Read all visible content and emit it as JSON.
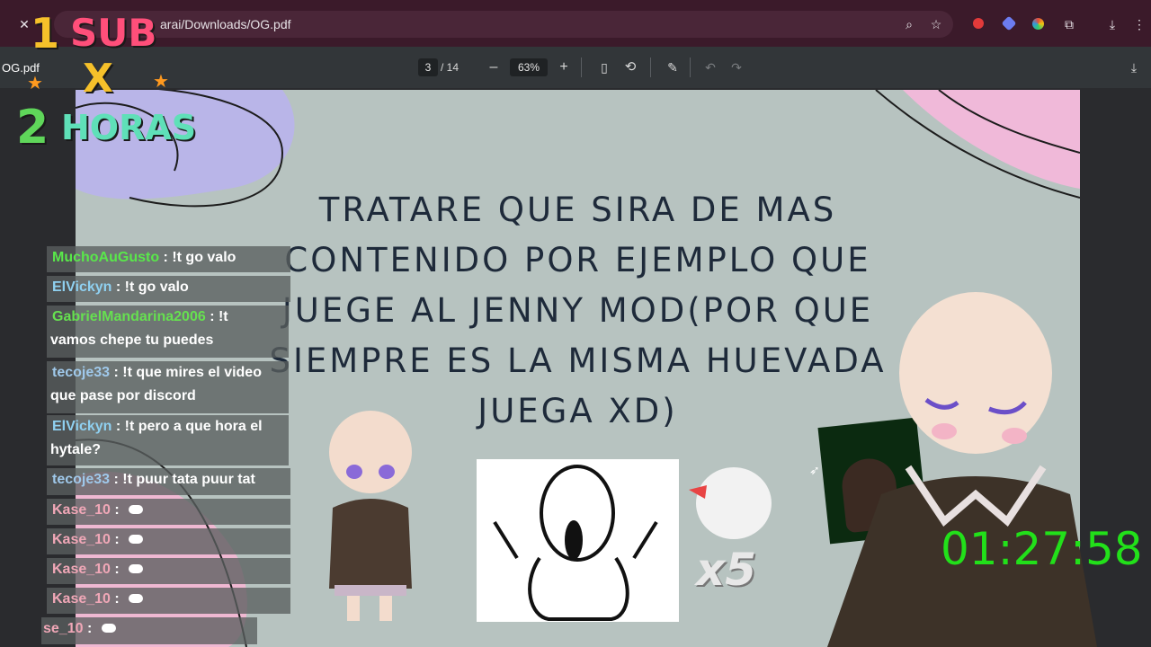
{
  "browser": {
    "url_partial": "arai/Downloads/OG.pdf",
    "tab_file": "OG.pdf"
  },
  "pdf_toolbar": {
    "page_current": "3",
    "page_total": "/ 14",
    "zoom": "63%",
    "zoom_out": "–",
    "zoom_in": "+"
  },
  "slide": {
    "lines": [
      "TRATARE QUE SIRA DE MAS",
      "CONTENIDO POR EJEMPLO QUE",
      "JUEGE AL JENNY MOD(POR QUE",
      "SIEMPRE ES LA MISMA HUEVADA",
      "JUEGA XD)"
    ]
  },
  "overlay": {
    "sub_count": "1",
    "sub_label": "SUB",
    "multiplier": "X",
    "hours_count": "2",
    "hours_label": "HORAS"
  },
  "chat": [
    {
      "user": "MuchoAuGusto",
      "text": " : !t go valo"
    },
    {
      "user": "ElVickyn",
      "text": " : !t go valo"
    },
    {
      "user": "GabrielMandarina2006",
      "text": " : !t",
      "text2": "vamos chepe tu puedes"
    },
    {
      "user": "tecoje33",
      "text": " : !t que mires el video",
      "text2": "que pase por discord"
    },
    {
      "user": "ElVickyn",
      "text": " : !t pero a que hora el",
      "text2": "hytale?"
    },
    {
      "user": "tecoje33",
      "text": " : !t puur tata puur tat"
    },
    {
      "user": "Kase_10",
      "text": " :"
    },
    {
      "user": "Kase_10",
      "text": " :"
    },
    {
      "user": "Kase_10",
      "text": " :"
    },
    {
      "user": "Kase_10",
      "text": " :"
    },
    {
      "user": "se_10",
      "text": " :"
    }
  ],
  "sticker_label": "x5",
  "timer": "01:27:58",
  "colors": {
    "chrome": "#3b1a2a",
    "pdf_toolbar": "#323639",
    "slide_bg": "#b7c3c0",
    "timer": "#22e01a"
  }
}
